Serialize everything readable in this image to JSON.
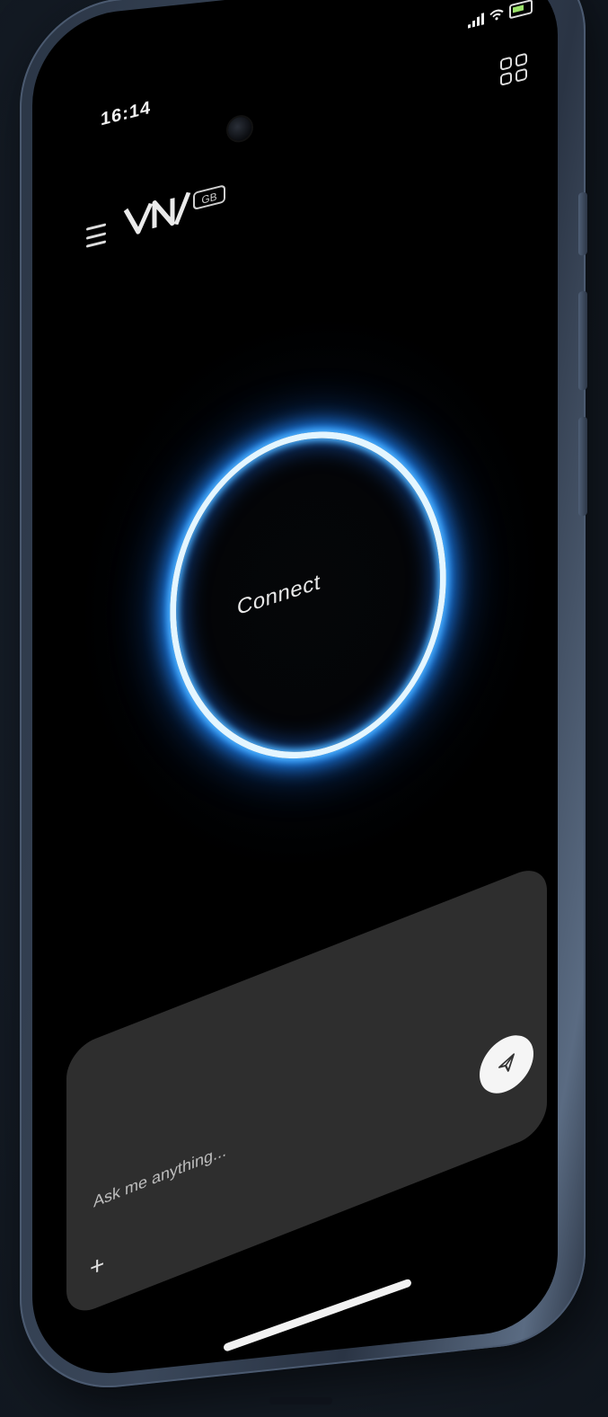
{
  "status_bar": {
    "time": "16:14"
  },
  "header": {
    "logo_text": "VN/",
    "logo_badge": "GB",
    "menu_icon": "hamburger-menu-icon",
    "grid_icon": "grid-apps-icon"
  },
  "main": {
    "connect_label": "Connect",
    "ring_color": "#2a9dff"
  },
  "composer": {
    "placeholder": "Ask me anything...",
    "attach_label": "+",
    "send_icon": "send-icon"
  },
  "colors": {
    "background": "#151c26",
    "screen": "#000000",
    "composer": "#2e2e2e",
    "accent": "#2a9dff"
  }
}
